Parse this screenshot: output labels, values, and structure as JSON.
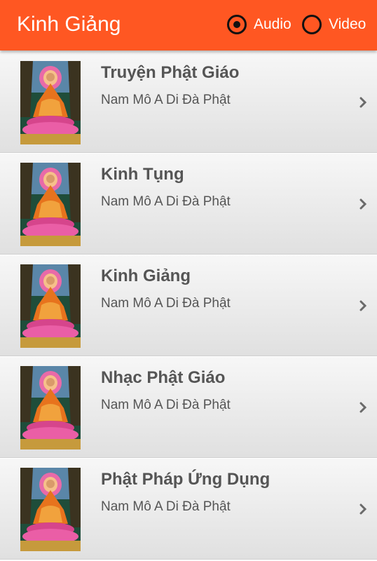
{
  "app": {
    "title": "Kinh Giảng"
  },
  "media_toggle": {
    "audio": {
      "label": "Audio",
      "selected": true
    },
    "video": {
      "label": "Video",
      "selected": false
    }
  },
  "list": {
    "items": [
      {
        "title": "Truyện Phật Giáo",
        "subtitle": "Nam Mô A Di Đà Phật"
      },
      {
        "title": "Kinh Tụng",
        "subtitle": "Nam Mô A Di Đà Phật"
      },
      {
        "title": "Kinh Giảng",
        "subtitle": "Nam Mô A Di Đà Phật"
      },
      {
        "title": "Nhạc Phật Giáo",
        "subtitle": "Nam Mô A Di Đà Phật"
      },
      {
        "title": "Phật Pháp Ứng Dụng",
        "subtitle": "Nam Mô A Di Đà Phật"
      }
    ]
  },
  "colors": {
    "appbar": "#ff5722",
    "text": "#555555",
    "radio": "#111111"
  },
  "icons": {
    "thumbnail": "buddha-image",
    "chevron": "chevron-right-icon"
  }
}
